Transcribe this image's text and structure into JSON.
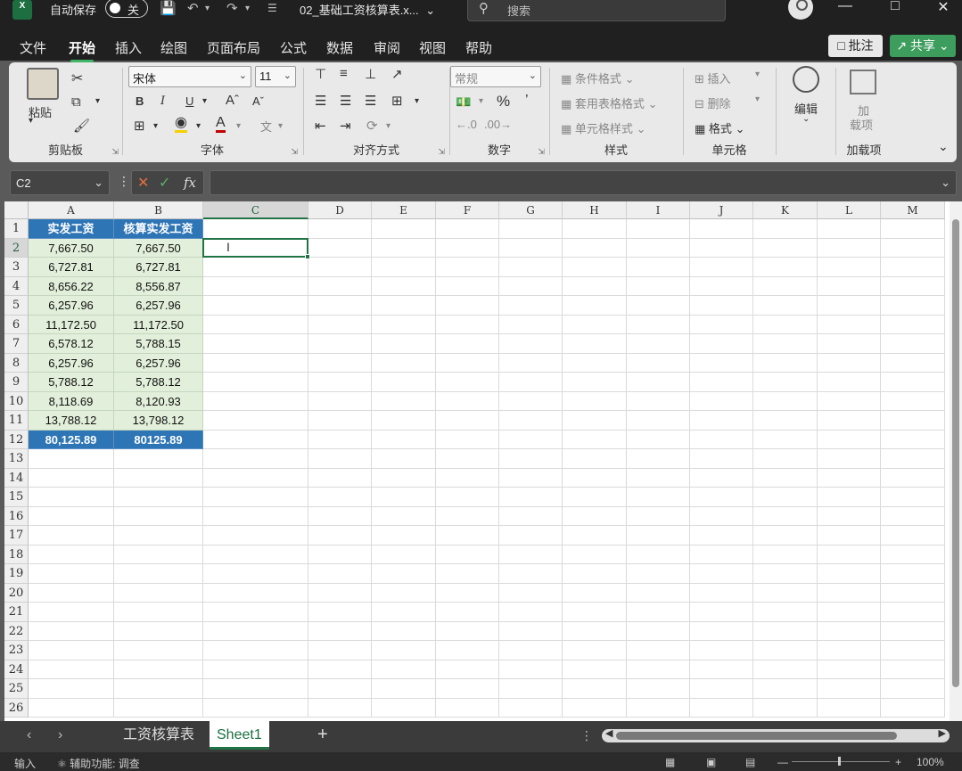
{
  "titlebar": {
    "app_logo": "X",
    "autosave_label": "自动保存",
    "autosave_state": "关",
    "document_title": "02_基础工资核算表.x...",
    "search_placeholder": "搜索",
    "icons": [
      "save-icon",
      "undo-icon",
      "redo-icon",
      "customize-icon",
      "avatar-icon",
      "minimize-icon",
      "restore-icon",
      "close-icon"
    ]
  },
  "menu": {
    "tabs": [
      "文件",
      "开始",
      "插入",
      "绘图",
      "页面布局",
      "公式",
      "数据",
      "审阅",
      "视图",
      "帮助"
    ],
    "active_tab": "开始",
    "comment_button": "批注",
    "share_button": "共享"
  },
  "ribbon": {
    "clipboard": {
      "label": "剪贴板",
      "paste": "粘贴"
    },
    "font": {
      "label": "字体",
      "font_name": "宋体",
      "font_size": "11",
      "bold": "B",
      "italic": "I",
      "underline": "U"
    },
    "alignment": {
      "label": "对齐方式"
    },
    "number": {
      "label": "数字",
      "format": "常规",
      "percent": "%"
    },
    "styles": {
      "label": "样式",
      "conditional": "条件格式",
      "table_format": "套用表格格式",
      "cell_style": "单元格样式"
    },
    "cells": {
      "label": "单元格",
      "insert": "插入",
      "delete": "删除",
      "format": "格式"
    },
    "editing": {
      "label": "编辑"
    },
    "addins": {
      "label": "加载项",
      "button_line1": "加",
      "button_line2": "载项"
    }
  },
  "formula_bar": {
    "name_box": "C2",
    "formula": "",
    "fx": "fx"
  },
  "grid": {
    "columns": [
      "A",
      "B",
      "C",
      "D",
      "E",
      "F",
      "G",
      "H",
      "I",
      "J",
      "K",
      "L",
      "M"
    ],
    "rows": [
      "1",
      "2",
      "3",
      "4",
      "5",
      "6",
      "7",
      "8",
      "9",
      "10",
      "11",
      "12",
      "13",
      "14",
      "15",
      "16",
      "17",
      "18",
      "19",
      "20",
      "21",
      "22",
      "23",
      "24",
      "25",
      "26"
    ],
    "active_cell": "C2",
    "headers": [
      "实发工资",
      "核算实发工资"
    ],
    "data": [
      [
        "7,667.50",
        "7,667.50"
      ],
      [
        "6,727.81",
        "6,727.81"
      ],
      [
        "8,656.22",
        "8,556.87"
      ],
      [
        "6,257.96",
        "6,257.96"
      ],
      [
        "11,172.50",
        "11,172.50"
      ],
      [
        "6,578.12",
        "5,788.15"
      ],
      [
        "6,257.96",
        "6,257.96"
      ],
      [
        "5,788.12",
        "5,788.12"
      ],
      [
        "8,118.69",
        "8,120.93"
      ],
      [
        "13,788.12",
        "13,798.12"
      ]
    ],
    "totals": [
      "80,125.89",
      "80125.89"
    ]
  },
  "sheets": {
    "tabs": [
      "工资核算表",
      "Sheet1"
    ],
    "active": "Sheet1",
    "add": "+"
  },
  "status": {
    "mode": "输入",
    "accessibility": "辅助功能: 调查",
    "zoom": "100%"
  }
}
